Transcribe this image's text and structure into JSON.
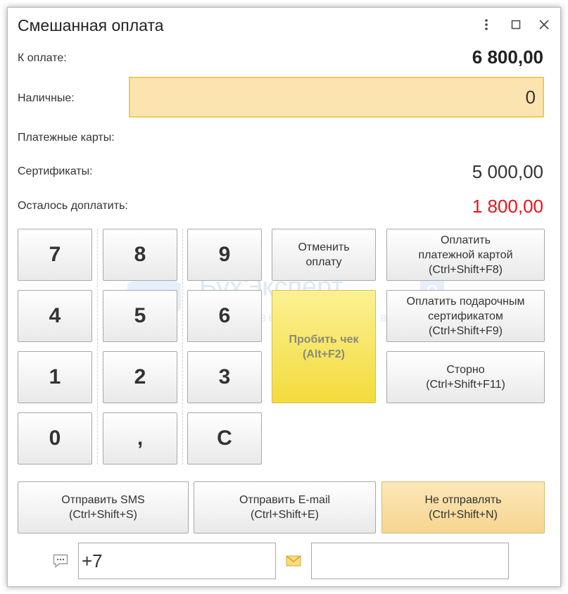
{
  "window": {
    "title": "Смешанная оплата"
  },
  "rows": {
    "to_pay_label": "К оплате:",
    "to_pay_value": "6 800,00",
    "cash_label": "Наличные:",
    "cash_value": "0",
    "cards_label": "Платежные карты:",
    "certs_label": "Сертификаты:",
    "certs_value": "5 000,00",
    "remaining_label": "Осталось доплатить:",
    "remaining_value": "1 800,00"
  },
  "keypad": [
    "7",
    "8",
    "9",
    "4",
    "5",
    "6",
    "1",
    "2",
    "3",
    "0",
    ",",
    "C"
  ],
  "actions": {
    "cancel": "Отменить\nоплату",
    "print_check": "Пробить чек\n(Alt+F2)",
    "pay_card": "Оплатить\nплатежной картой\n(Ctrl+Shift+F8)",
    "pay_gift": "Оплатить подарочным\nсертификатом\n(Ctrl+Shift+F9)",
    "storno": "Сторно\n(Ctrl+Shift+F11)"
  },
  "send": {
    "sms": "Отправить SMS\n(Ctrl+Shift+S)",
    "email": "Отправить E-mail\n(Ctrl+Shift+E)",
    "none": "Не отправлять\n(Ctrl+Shift+N)"
  },
  "contact": {
    "phone_value": "+7",
    "email_value": ""
  },
  "watermark": {
    "name": "БухЭксперт",
    "badge": "8",
    "subtitle": "База ответов по учету в 1С"
  },
  "colors": {
    "remaining": "#e8141b",
    "cash_field_bg": "#fce4b0",
    "print_button": "#f5e15a",
    "none_button": "#f9dfa6"
  },
  "icons": [
    "more-vert-icon",
    "maximize-icon",
    "close-icon",
    "sms-icon",
    "email-icon"
  ]
}
